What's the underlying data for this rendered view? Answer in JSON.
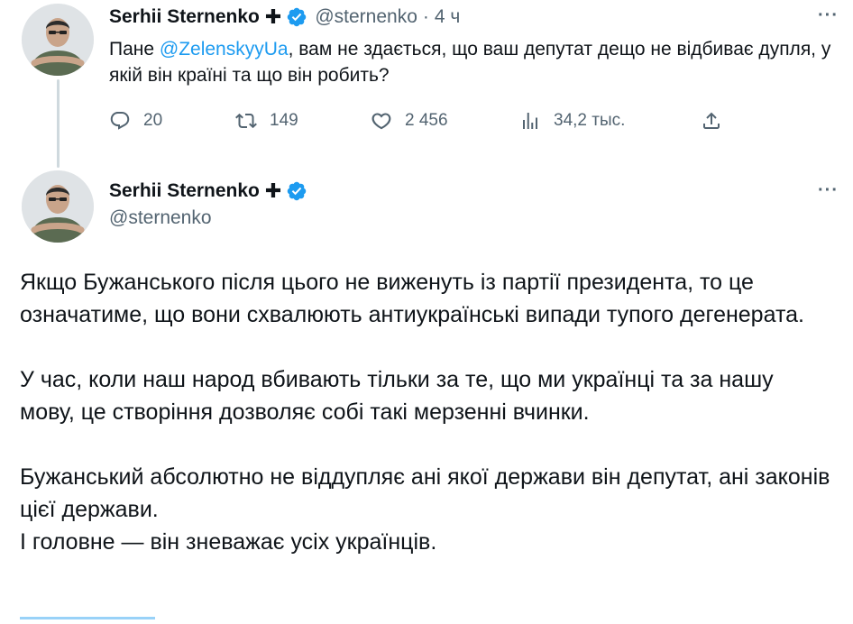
{
  "reply_tweet": {
    "display_name": "Serhii Sternenko",
    "cross": "✚",
    "handle": "@sternenko",
    "separator": "·",
    "time": "4 ч",
    "more": "···",
    "text_before": "Пане ",
    "mention": "@ZelenskyyUa",
    "text_after": ", вам не здається, що ваш депутат дещо не відбиває дупля, у якій він країні та що він робить?",
    "actions": {
      "replies": "20",
      "reposts": "149",
      "likes": "2 456",
      "views": "34,2 тыс."
    }
  },
  "main_tweet": {
    "display_name": "Serhii Sternenko",
    "cross": "✚",
    "handle": "@sternenko",
    "more": "···",
    "paragraph1": "Якщо Бужанського після цього не виженуть із партії президента, то це означатиме, що вони схвалюють антиукраїнські випади тупого дегенерата.",
    "paragraph2": "У час, коли наш народ вбивають тільки за те, що ми українці та за нашу мову, це створіння дозволяє собі такі мерзенні вчинки.",
    "paragraph3_line1": "Бужанський абсолютно не віддупляє ані якої держави він депутат, ані законів цієї держави.",
    "paragraph3_line2": "І головне — він зневажає усіх українців."
  },
  "colors": {
    "accent": "#1d9bf0",
    "muted": "#536471",
    "text": "#0f1419",
    "thread_line": "#cfd9de"
  },
  "icons": [
    "verified-badge-icon",
    "reply-icon",
    "repost-icon",
    "like-icon",
    "views-icon",
    "share-icon",
    "more-icon"
  ]
}
